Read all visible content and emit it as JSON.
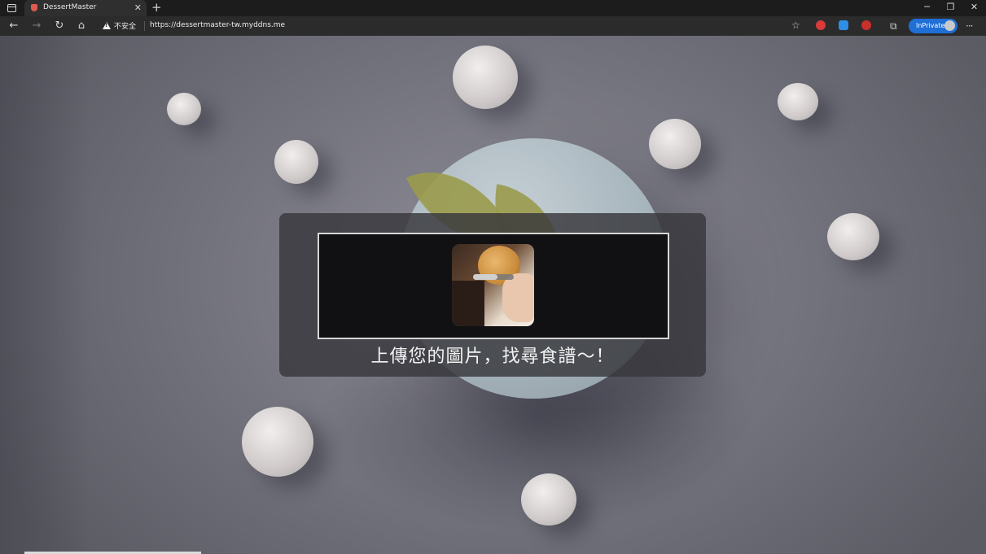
{
  "browser": {
    "tab": {
      "title": "DessertMaster",
      "close_label": "✕"
    },
    "new_tab_label": "+",
    "window_controls": {
      "minimize": "─",
      "restore": "❐",
      "close": "✕"
    },
    "nav": {
      "back": "←",
      "forward": "→",
      "reload": "↻",
      "home": "⌂"
    },
    "security_label": "不安全",
    "url": "https://dessertmaster-tw.myddns.me",
    "inprivate_label": "InPrivate",
    "more_label": "···"
  },
  "upload": {
    "prompt": "上傳您的圖片，找尋食譜～！",
    "progress": 0.6
  },
  "colors": {
    "card_bg": "#37373c",
    "drop_zone_bg": "#111114",
    "drop_zone_border": "#d6d6d6",
    "inprivate_accent": "#1f6fd6"
  },
  "icons": [
    "tab-actions-icon",
    "favicon-icon",
    "warning-icon",
    "favorites-star-icon",
    "abp-extension-icon",
    "translate-extension-icon",
    "extension-icon",
    "collections-icon",
    "profile-avatar-icon",
    "more-icon"
  ]
}
